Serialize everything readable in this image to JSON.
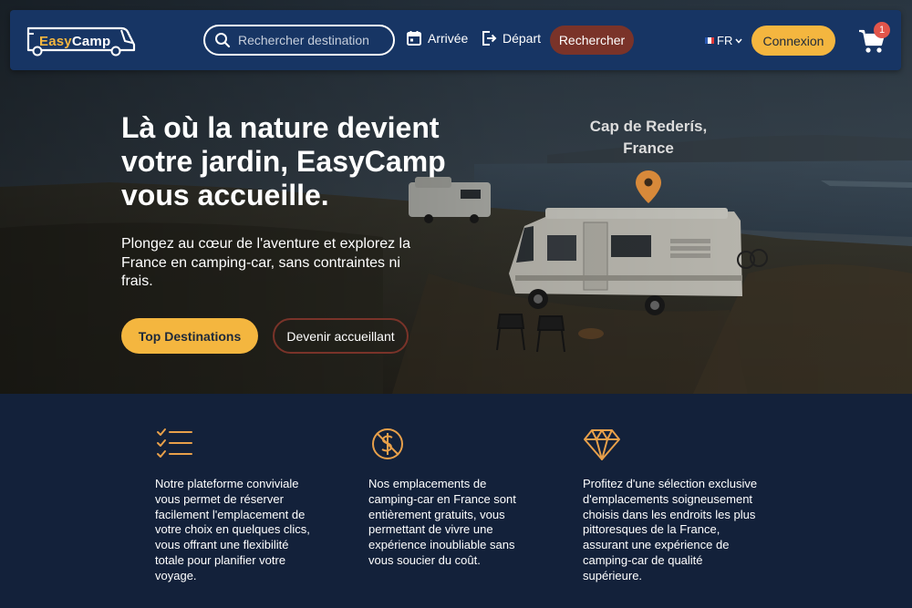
{
  "brand": {
    "part1": "Easy",
    "part2": "Camp"
  },
  "nav": {
    "search_placeholder": "Rechercher destination",
    "arrivee_label": "Arrivée",
    "depart_label": "Départ",
    "rechercher_label": "Rechercher",
    "language": "FR",
    "connexion_label": "Connexion",
    "cart_count": "1"
  },
  "hero": {
    "title": "Là où la nature devient votre jardin, EasyCamp vous accueille.",
    "subtitle": "Plongez au cœur de l'aventure et explorez la France en camping-car, sans contraintes ni frais.",
    "primary_button": "Top Destinations",
    "secondary_button": "Devenir accueillant",
    "location_line1": "Cap de Rederís,",
    "location_line2": "France"
  },
  "features": [
    {
      "icon": "checklist-icon",
      "text": "Notre plateforme conviviale vous permet de réserver facilement l'emplacement de votre choix en quelques clics, vous offrant une flexibilité totale pour planifier votre voyage."
    },
    {
      "icon": "no-cost-icon",
      "text": "Nos emplacements de camping-car en France sont entièrement gratuits, vous permettant de vivre une expérience inoubliable sans vous soucier du coût."
    },
    {
      "icon": "diamond-icon",
      "text": "Profitez d'une sélection exclusive d'emplacements soigneusement choisis dans les endroits les plus pittoresques de la France, assurant une expérience de camping-car de qualité supérieure."
    }
  ],
  "colors": {
    "nav_bg": "#173564",
    "accent_yellow": "#f4b63f",
    "accent_rust": "#7a3329",
    "page_bg": "#13213a",
    "icon_orange": "#e8a04a"
  }
}
